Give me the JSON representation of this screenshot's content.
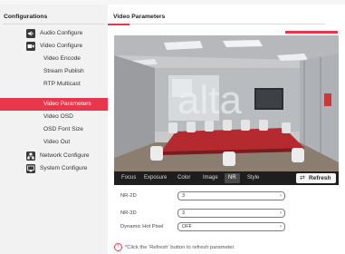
{
  "colors": {
    "accent": "#e8374d",
    "sidebar_bg": "#f2f2f2",
    "toolbar_bg": "#1e1e1e"
  },
  "sidebar": {
    "title": "Configurations",
    "items": [
      {
        "label": "Audio Configure",
        "icon": "speaker-icon"
      },
      {
        "label": "Video Configure",
        "icon": "video-icon"
      },
      {
        "label": "Video Encode"
      },
      {
        "label": "Stream Publish"
      },
      {
        "label": "RTP Multicast"
      },
      {
        "label": "Video Parameters",
        "active": true
      },
      {
        "label": "Video OSD"
      },
      {
        "label": "OSD Font Size"
      },
      {
        "label": "Video Out"
      },
      {
        "label": "Network Configure",
        "icon": "network-icon"
      },
      {
        "label": "System Configure",
        "icon": "system-icon"
      }
    ]
  },
  "main": {
    "title": "Video Parameters",
    "tabs": [
      "Focus",
      "Exposure",
      "Color",
      "Image",
      "NR",
      "Style"
    ],
    "active_tab": "NR",
    "refresh_label": "Refresh",
    "fields": [
      {
        "label": "NR-2D",
        "value": "3"
      },
      {
        "label": "NR-3D",
        "value": "3"
      },
      {
        "label": "Dynamic Hot Pixel",
        "value": "OFF"
      }
    ],
    "hint": "*Click the 'Refresh' button to refresh parameter."
  }
}
